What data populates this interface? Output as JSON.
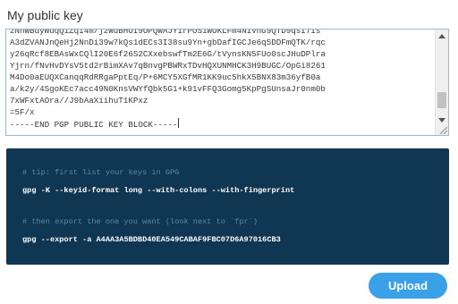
{
  "form": {
    "label": "My public key",
    "key_lines": [
      "zNhWBdyWuqQ1ZqI4m/j2WdBHOI9OPQWAJYIrPOS1WOKLFm4NIVnG9QTD9qsI7Is",
      "A3dZVANJnQeHj2NnDi39w7kQs1dECs3I38su9Yn+gbDafIGCJe6q5DDFmQTK/rqc",
      "y26qRcf8EBAsWxCQlI20E6f26S2CXxebswfTm2E6G/tVynsKN5FUo0scJHuDPlra",
      "Yjrn/fNvHvDYsV5td2rBimXAv7qBnvgPBWRxTDvHQXUNMHCK3H9BUGC/OpGi8261",
      "M4Do0aEUQXCanqqRdRRgaPptEq/P+6MCY5XGfMR1KK9uc5hkX5BNX83m36yfB0a",
      "a/k2y/4SgoKEc7acc49N0KnsVWYfQbk5G1+k91vFFQ3Gomg5KpPgSUnsaJr0nm0b",
      "7xWFxtAOra//J9bAaXiihuT1KPxz",
      "=5F/x",
      "-----END PGP PUBLIC KEY BLOCK-----"
    ]
  },
  "code": {
    "comment1": "# tip: first list your keys in GPG",
    "command1": "gpg -K --keyid-format long --with-colons --with-fingerprint",
    "comment2": "# then export the one you want (look next to `fpr`)",
    "command2": "gpg --export -a A4AA3A5BDBD40EA549CABAF9FBC07D6A97016CB3"
  },
  "actions": {
    "upload_label": "Upload"
  },
  "colors": {
    "code_bg": "#0f3652",
    "button_bg": "#3aa0e8",
    "textarea_border": "#9fb6cf"
  }
}
